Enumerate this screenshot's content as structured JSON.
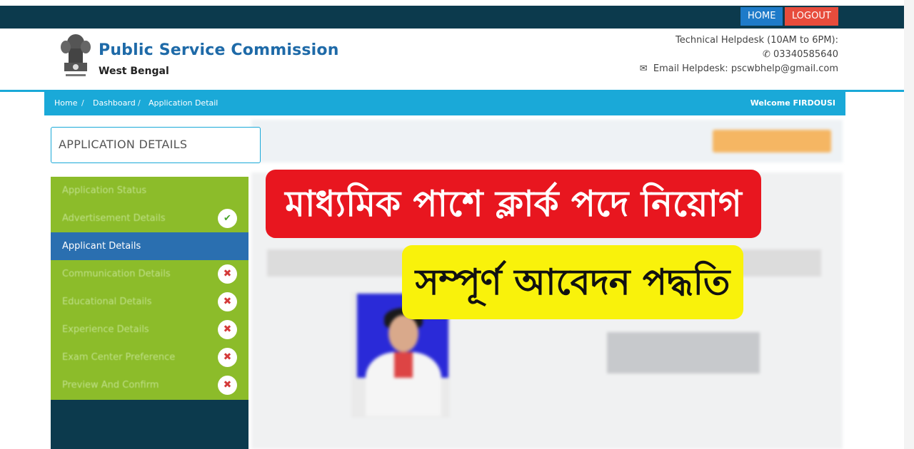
{
  "topbar": {
    "home_label": "HOME",
    "logout_label": "LOGOUT"
  },
  "header": {
    "org_title": "Public Service Commission",
    "org_subtitle": "West Bengal",
    "helpdesk_title": "Technical Helpdesk (10AM to 6PM):",
    "helpdesk_phone": "03340585640",
    "email_label": "Email Helpdesk:",
    "email_value": "pscwbhelp@gmail.com"
  },
  "breadcrumb": {
    "items": [
      "Home",
      "Dashboard",
      "Application Detail"
    ],
    "separator": "/",
    "welcome": "Welcome FIRDOUSI"
  },
  "page": {
    "title": "APPLICATION DETAILS"
  },
  "sidebar": {
    "items": [
      {
        "label": "Application Status",
        "status": ""
      },
      {
        "label": "Advertisement Details",
        "status": "complete"
      },
      {
        "label": "Applicant Details",
        "status": "active"
      },
      {
        "label": "Communication Details",
        "status": "incomplete"
      },
      {
        "label": "Educational Details",
        "status": "incomplete"
      },
      {
        "label": "Experience Details",
        "status": "incomplete"
      },
      {
        "label": "Exam Center Preference",
        "status": "incomplete"
      },
      {
        "label": "Preview And Confirm",
        "status": "incomplete"
      }
    ]
  },
  "banners": {
    "primary": "মাধ্যমিক পাশে ক্লার্ক পদে নিয়োগ",
    "secondary": "সম্পূর্ণ আবেদন পদ্ধতি"
  },
  "icons": {
    "check": "check-icon",
    "cross": "cross-icon",
    "phone": "phone-icon",
    "mail": "envelope-icon"
  },
  "colors": {
    "topbar": "#0c3a4d",
    "accent": "#1aa9d8",
    "sidebar_green": "#8cbc2a",
    "sidebar_active": "#2a6fb0",
    "banner_red": "#e8161f",
    "banner_yellow": "#f9f20b"
  }
}
